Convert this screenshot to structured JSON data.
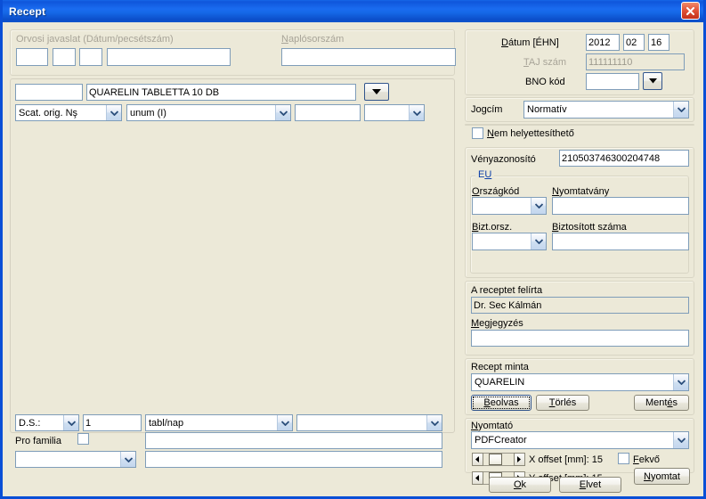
{
  "window": {
    "title": "Recept",
    "close_icon": "close-x-icon"
  },
  "left": {
    "advice_group": {
      "legend": "Orvosi javaslat (Dátum/pecsétszám)",
      "field1": "",
      "field2": "",
      "field3": "",
      "field4": ""
    },
    "journal": {
      "label": "Naplósorszám",
      "value": ""
    },
    "medication": {
      "code": "",
      "name": "QUARELIN TABLETTA 10 DB",
      "lookup_icon": "dropdown-arrow-icon",
      "form": "Scat. orig. Nş",
      "quantity": "unum (I)",
      "extra1": "",
      "extra2": ""
    },
    "dosage": {
      "ds_label": "D.S.:",
      "amount": "1",
      "unit": "tabl/nap",
      "extra": "",
      "pro_familia_label": "Pro familia",
      "pro_familia_checked": false,
      "note1": "",
      "select_extra": "",
      "note2": ""
    }
  },
  "right": {
    "date": {
      "label": "Dátum [ÉHN]",
      "year": "2012",
      "month": "02",
      "day": "16"
    },
    "taj": {
      "label": "TAJ szám",
      "value": "111111110"
    },
    "bno": {
      "label": "BNO kód",
      "value": "",
      "lookup_icon": "dropdown-arrow-icon"
    },
    "jogcim": {
      "label": "Jogcím",
      "value": "Normatív"
    },
    "no_substitute": {
      "label": "Nem helyettesíthető",
      "checked": false
    },
    "prescription_id": {
      "label": "Vényazonosító",
      "value": "210503746300204748"
    },
    "eu": {
      "legend": "EU",
      "country_code_label": "Országkód",
      "country_code_value": "",
      "form_label": "Nyomtatvány",
      "form_value": "",
      "insurer_country_label": "Bizt.orsz.",
      "insurer_country_value": "",
      "insured_number_label": "Biztosított száma",
      "insured_number_value": ""
    },
    "prescriber": {
      "label": "A receptet felírta",
      "value": "Dr. Sec Kálmán",
      "note_label": "Megjegyzés",
      "note_value": ""
    },
    "template": {
      "label": "Recept minta",
      "value": "QUARELIN",
      "load_button": "Beolvas",
      "delete_button": "Törlés",
      "save_button": "Mentés"
    },
    "printer": {
      "label": "Nyomtató",
      "value": "PDFCreator",
      "x_offset_label": "X offset [mm]: 15",
      "y_offset_label": "Y offset [mm]: 15",
      "landscape_label": "Fekvő",
      "landscape_checked": false,
      "print_button": "Nyomtat"
    },
    "footer": {
      "ok_button": "Ok",
      "cancel_button": "Elvet"
    }
  }
}
